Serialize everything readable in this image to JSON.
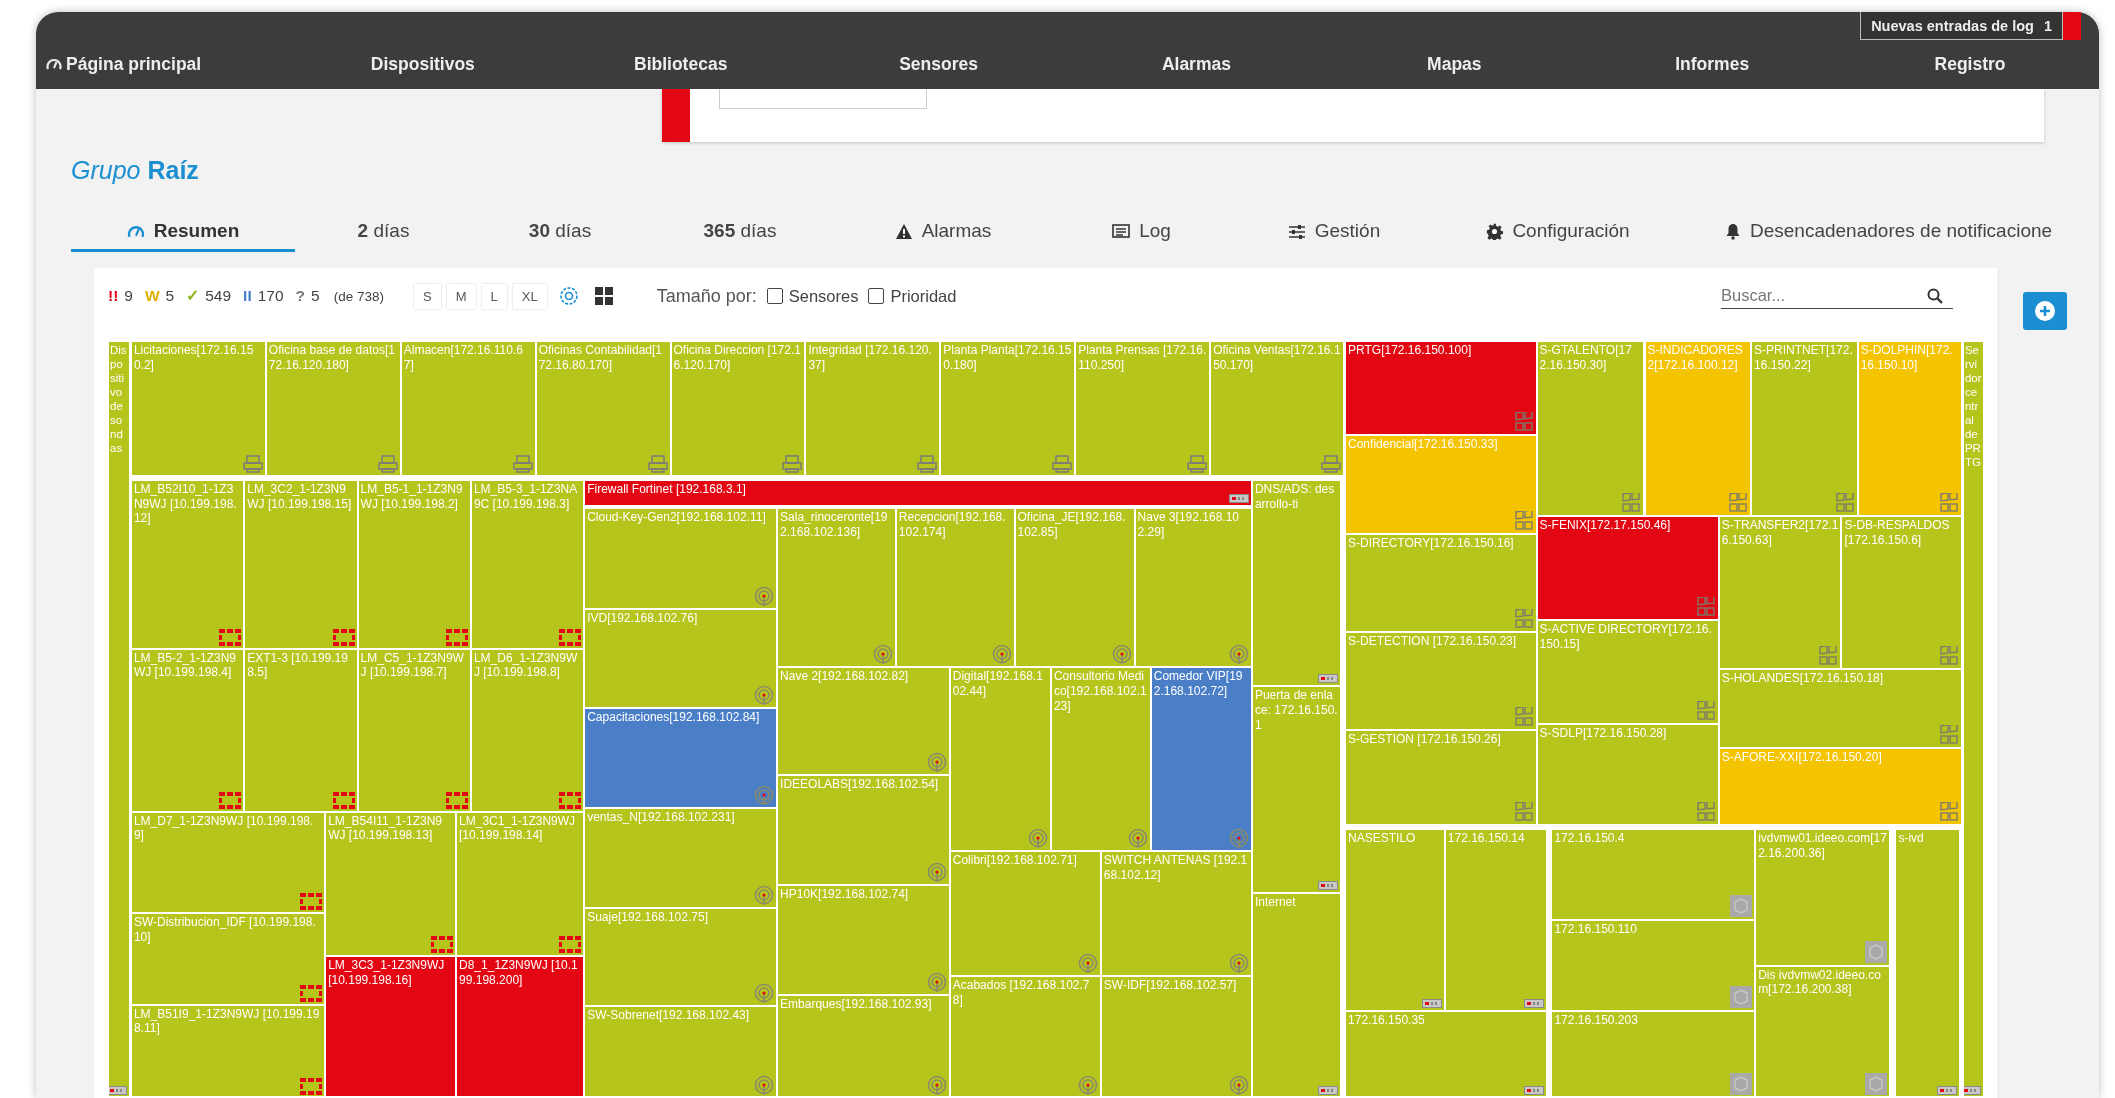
{
  "nav": {
    "items": [
      {
        "label": "Página principal",
        "kind": "home"
      },
      {
        "label": "Dispositivos",
        "kind": "plain"
      },
      {
        "label": "Bibliotecas",
        "kind": "plain"
      },
      {
        "label": "Sensores",
        "kind": "plain"
      },
      {
        "label": "Alarmas",
        "kind": "plain"
      },
      {
        "label": "Mapas",
        "kind": "plain"
      },
      {
        "label": "Informes",
        "kind": "plain"
      },
      {
        "label": "Registro",
        "kind": "plain"
      }
    ],
    "log_notice": {
      "label": "Nuevas entradas de log",
      "count": "1"
    }
  },
  "title": "*Grupo* **Raíz**",
  "tabs": [
    {
      "label": "Resumen",
      "kind": "gauge",
      "selected": true
    },
    {
      "label": "**2** días",
      "kind": "period",
      "selected": false
    },
    {
      "label": "**30** días",
      "kind": "period",
      "selected": false
    },
    {
      "label": "**365** días",
      "kind": "period",
      "selected": false
    },
    {
      "label": "Alarmas",
      "kind": "warning",
      "selected": false
    },
    {
      "label": "Log",
      "kind": "log",
      "selected": false
    },
    {
      "label": "Gestión",
      "kind": "sliders",
      "selected": false
    },
    {
      "label": "Configuración",
      "kind": "gear",
      "selected": false
    },
    {
      "label": "Desencadenadores de notificacione",
      "kind": "bell",
      "selected": false
    }
  ],
  "toolbar": {
    "status_counts": [
      {
        "icon": "!!",
        "count": "9",
        "color": "#e30613"
      },
      {
        "icon": "W",
        "count": "5",
        "color": "#e0b000"
      },
      {
        "icon": "✓",
        "count": "549",
        "color": "#8db31b"
      },
      {
        "icon": "II",
        "count": "170",
        "color": "#4a7fc8"
      },
      {
        "icon": "?",
        "count": "5",
        "color": "#777777"
      }
    ],
    "total": "(de 738)",
    "sizes": [
      "S",
      "M",
      "L",
      "XL"
    ],
    "size_by": {
      "label": "Tamaño por:",
      "options": [
        {
          "label": "Sensores",
          "checked": false
        },
        {
          "label": "Prioridad",
          "checked": false
        }
      ]
    },
    "search": {
      "placeholder": "Buscar..."
    }
  },
  "treemap": {
    "tiles": [
      {
        "label": "Dispositivo de sondas",
        "color": "#b6c51c",
        "kind": "network"
      },
      {
        "label": "Licitaciones[172.16.150.2]",
        "color": "#b6c51c",
        "kind": "printer"
      },
      {
        "label": "Oficina base de datos[172.16.120.180]",
        "color": "#b6c51c",
        "kind": "printer"
      },
      {
        "label": "Almacen[172.16.110.67]",
        "color": "#b6c51c",
        "kind": "printer"
      },
      {
        "label": "Oficinas Contabilidad[172.16.80.170]",
        "color": "#b6c51c",
        "kind": "printer"
      },
      {
        "label": "Oficina Direccion [172.16.120.170]",
        "color": "#b6c51c",
        "kind": "printer"
      },
      {
        "label": "Integridad [172.16.120.37]",
        "color": "#b6c51c",
        "kind": "printer"
      },
      {
        "label": "Planta Planta[172.16.150.180]",
        "color": "#b6c51c",
        "kind": "printer"
      },
      {
        "label": "Planta Prensas [172.16.110.250]",
        "color": "#b6c51c",
        "kind": "printer"
      },
      {
        "label": "Oficina Ventas[172.16.150.170]",
        "color": "#b6c51c",
        "kind": "printer"
      },
      {
        "label": "LM_B52I10_1-1Z3N9WJ [10.199.198.12]",
        "color": "#b6c51c",
        "kind": "firewall"
      },
      {
        "label": "LM_3C2_1-1Z3N9WJ [10.199.198.15]",
        "color": "#b6c51c",
        "kind": "firewall"
      },
      {
        "label": "LM_B5-1_1-1Z3N9WJ [10.199.198.2]",
        "color": "#b6c51c",
        "kind": "firewall"
      },
      {
        "label": "LM_B5-3_1-1Z3NA9C [10.199.198.3]",
        "color": "#b6c51c",
        "kind": "firewall"
      },
      {
        "label": "LM_B5-2_1-1Z3N9WJ [10.199.198.4]",
        "color": "#b6c51c",
        "kind": "firewall"
      },
      {
        "label": "EXT1-3 [10.199.198.5]",
        "color": "#b6c51c",
        "kind": "firewall"
      },
      {
        "label": "LM_C5_1-1Z3N9WJ [10.199.198.7]",
        "color": "#b6c51c",
        "kind": "firewall"
      },
      {
        "label": "LM_D6_1-1Z3N9WJ [10.199.198.8]",
        "color": "#b6c51c",
        "kind": "firewall"
      },
      {
        "label": "LM_D7_1-1Z3N9WJ [10.199.198.9]",
        "color": "#b6c51c",
        "kind": "firewall"
      },
      {
        "label": "SW-Distribucion_IDF [10.199.198.10]",
        "color": "#b6c51c",
        "kind": "firewall"
      },
      {
        "label": "LM_B51I9_1-1Z3N9WJ [10.199.198.11]",
        "color": "#b6c51c",
        "kind": "firewall"
      },
      {
        "label": "LM_B54I11_1-1Z3N9WJ [10.199.198.13]",
        "color": "#b6c51c",
        "kind": "firewall"
      },
      {
        "label": "LM_3C1_1-1Z3N9WJ [10.199.198.14]",
        "color": "#b6c51c",
        "kind": "firewall"
      },
      {
        "label": "LM_3C3_1-1Z3N9WJ [10.199.198.16]",
        "color": "#e30613",
        "kind": "none"
      },
      {
        "label": "D8_1_1Z3N9WJ [10.199.198.200]",
        "color": "#e30613",
        "kind": "none"
      },
      {
        "label": "Firewall Fortinet [192.168.3.1]",
        "color": "#e30613",
        "kind": "network"
      },
      {
        "label": "Cloud-Key-Gen2[192.168.102.11]",
        "color": "#b6c51c",
        "kind": "antenna"
      },
      {
        "label": "IVD[192.168.102.76]",
        "color": "#b6c51c",
        "kind": "antenna"
      },
      {
        "label": "Capacitaciones[192.168.102.84]",
        "color": "#4a7fc8",
        "kind": "antenna"
      },
      {
        "label": "ventas_N[192.168.102.231]",
        "color": "#b6c51c",
        "kind": "antenna"
      },
      {
        "label": "Suaje[192.168.102.75]",
        "color": "#b6c51c",
        "kind": "antenna"
      },
      {
        "label": "SW-Sobrenet[192.168.102.43]",
        "color": "#b6c51c",
        "kind": "antenna"
      },
      {
        "label": "Sala_rinoceronte[192.168.102.136]",
        "color": "#b6c51c",
        "kind": "antenna"
      },
      {
        "label": "Recepcion[192.168.102.174]",
        "color": "#b6c51c",
        "kind": "antenna"
      },
      {
        "label": "Oficina_JE[192.168.102.85]",
        "color": "#b6c51c",
        "kind": "antenna"
      },
      {
        "label": "Nave 3[192.168.102.29]",
        "color": "#b6c51c",
        "kind": "antenna"
      },
      {
        "label": "Nave 2[192.168.102.82]",
        "color": "#b6c51c",
        "kind": "antenna"
      },
      {
        "label": "IDEEOLABS[192.168.102.54]",
        "color": "#b6c51c",
        "kind": "antenna"
      },
      {
        "label": "HP10K[192.168.102.74]",
        "color": "#b6c51c",
        "kind": "antenna"
      },
      {
        "label": "Embarques[192.168.102.93]",
        "color": "#b6c51c",
        "kind": "antenna"
      },
      {
        "label": "Digital[192.168.102.44]",
        "color": "#b6c51c",
        "kind": "antenna"
      },
      {
        "label": "Consultorio Medico[192.168.102.123]",
        "color": "#b6c51c",
        "kind": "antenna"
      },
      {
        "label": "Comedor VIP[192.168.102.72]",
        "color": "#4a7fc8",
        "kind": "antenna"
      },
      {
        "label": "Colibri[192.168.102.71]",
        "color": "#b6c51c",
        "kind": "antenna"
      },
      {
        "label": "SWITCH ANTENAS [192.168.102.12]",
        "color": "#b6c51c",
        "kind": "antenna"
      },
      {
        "label": "Acabados [192.168.102.78]",
        "color": "#b6c51c",
        "kind": "antenna"
      },
      {
        "label": "SW-IDF[192.168.102.57]",
        "color": "#b6c51c",
        "kind": "antenna"
      },
      {
        "label": "DNS/ADS: desarrollo-ti",
        "color": "#b6c51c",
        "kind": "network"
      },
      {
        "label": "Puerta de enlace: 172.16.150.1",
        "color": "#b6c51c",
        "kind": "network"
      },
      {
        "label": "Internet",
        "color": "#b6c51c",
        "kind": "network"
      },
      {
        "label": "PRTG[172.16.150.100]",
        "color": "#e30613",
        "kind": "server"
      },
      {
        "label": "Confidencial[172.16.150.33]",
        "color": "#f5c400",
        "kind": "server"
      },
      {
        "label": "S-DIRECTORY[172.16.150.16]",
        "color": "#b6c51c",
        "kind": "server"
      },
      {
        "label": "S-DETECTION [172.16.150.23]",
        "color": "#b6c51c",
        "kind": "server"
      },
      {
        "label": "S-GESTION [172.16.150.26]",
        "color": "#b6c51c",
        "kind": "server"
      },
      {
        "label": "S-GTALENTO[172.16.150.30]",
        "color": "#b6c51c",
        "kind": "server"
      },
      {
        "label": "S-INDICADORES2[172.16.100.12]",
        "color": "#f5c400",
        "kind": "server"
      },
      {
        "label": "S-PRINTNET[172.16.150.22]",
        "color": "#b6c51c",
        "kind": "server"
      },
      {
        "label": "S-DOLPHIN[172.16.150.10]",
        "color": "#f5c400",
        "kind": "server"
      },
      {
        "label": "S-FENIX[172.17.150.46]",
        "color": "#e30613",
        "kind": "server"
      },
      {
        "label": "S-ACTIVE DIRECTORY[172.16.150.15]",
        "color": "#b6c51c",
        "kind": "server"
      },
      {
        "label": "S-SDLP[172.16.150.28]",
        "color": "#b6c51c",
        "kind": "server"
      },
      {
        "label": "S-TRANSFER2[172.16.150.63]",
        "color": "#b6c51c",
        "kind": "server"
      },
      {
        "label": "S-DB-RESPALDOS[172.16.150.6]",
        "color": "#b6c51c",
        "kind": "server"
      },
      {
        "label": "S-HOLANDES[172.16.150.18]",
        "color": "#b6c51c",
        "kind": "server"
      },
      {
        "label": "S-AFORE-XXI[172.16.150.20]",
        "color": "#f5c400",
        "kind": "server"
      },
      {
        "label": "Servidor central de PRTG",
        "color": "#b6c51c",
        "kind": "network"
      },
      {
        "label": "NASESTILO",
        "color": "#b6c51c",
        "kind": "network"
      },
      {
        "label": "172.16.150.14",
        "color": "#b6c51c",
        "kind": "network"
      },
      {
        "label": "172.16.150.35",
        "color": "#b6c51c",
        "kind": "network"
      },
      {
        "label": "172.16.150.4",
        "color": "#b6c51c",
        "kind": "vm"
      },
      {
        "label": "172.16.150.110",
        "color": "#b6c51c",
        "kind": "vm"
      },
      {
        "label": "172.16.150.203",
        "color": "#b6c51c",
        "kind": "vm"
      },
      {
        "label": "ivdvmw01.ideeo.com[172.16.200.36]",
        "color": "#b6c51c",
        "kind": "vm"
      },
      {
        "label": "Dis ivdvmw02.ideeo.com[172.16.200.38]",
        "color": "#b6c51c",
        "kind": "vm"
      },
      {
        "label": "s-ivd",
        "color": "#b6c51c",
        "kind": "network"
      }
    ]
  }
}
